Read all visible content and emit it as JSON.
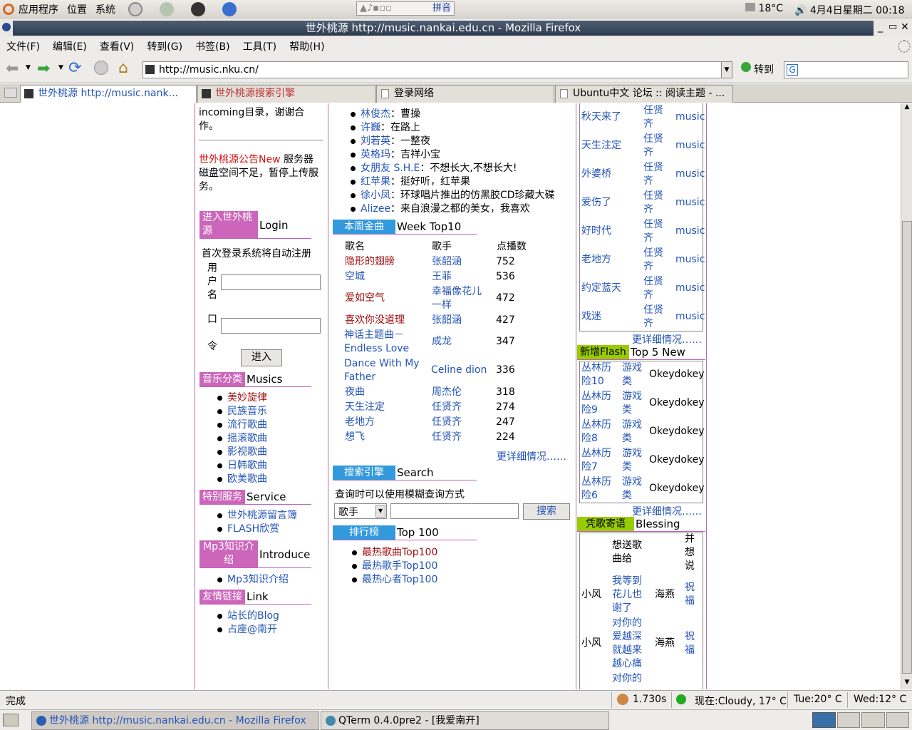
{
  "panel": {
    "apps": "应用程序",
    "places": "位置",
    "system": "系统",
    "ime_label": "拼音",
    "temp": "18°C",
    "datetime": "4月4日星期二  00:18"
  },
  "window": {
    "title": "世外桃源 http://music.nankai.edu.cn - Mozilla Firefox"
  },
  "menu": [
    "文件(F)",
    "编辑(E)",
    "查看(V)",
    "转到(G)",
    "书签(B)",
    "工具(T)",
    "帮助(H)"
  ],
  "nav": {
    "url": "http://music.nku.cn/",
    "go_label": "转到"
  },
  "tabs": [
    "世外桃源 http://music.nank...",
    "世外桃源搜索引擎",
    "登录网络",
    "Ubuntu中文 论坛 :: 阅读主题 - ..."
  ],
  "left": {
    "intro_text": "incoming目录，谢谢合作。",
    "notice_title": "世外桃源公告New",
    "notice_body": "服务器磁盘空间不足，暂停上传服务。",
    "login_tag": "进入世外桃源",
    "login_en": "Login",
    "login_note": "首次登录系统将自动注册",
    "user_label": "用户名",
    "pass_label": "口令",
    "enter_button": "进入",
    "music_tag": "音乐分类",
    "music_en": "Musics",
    "music_items": [
      "美妙旋律",
      "民族音乐",
      "流行歌曲",
      "摇滚歌曲",
      "影视歌曲",
      "日韩歌曲",
      "欧美歌曲"
    ],
    "service_tag": "特别服务",
    "service_en": "Service",
    "service_items": [
      "世外桃源留言簿",
      "FLASH欣赏"
    ],
    "mp3_tag": "Mp3知识介绍",
    "mp3_en": "Introduce",
    "mp3_items": [
      "Mp3知识介绍"
    ],
    "link_tag": "友情链接",
    "link_en": "Link",
    "link_items": [
      "站长的Blog",
      "占座@南开"
    ]
  },
  "middle": {
    "news": [
      {
        "who": "林俊杰",
        "what": "曹操"
      },
      {
        "who": "许巍",
        "what": "在路上"
      },
      {
        "who": "刘若英",
        "what": "一整夜"
      },
      {
        "who": "英格玛",
        "what": "吉祥小宝"
      },
      {
        "who": "女朋友 S.H.E",
        "what": "不想长大,不想长大!"
      },
      {
        "who": "红苹果",
        "what": "挺好听，红苹果"
      },
      {
        "who": "徐小凤",
        "what": "环球唱片推出的仿黑胶CD珍藏大碟"
      },
      {
        "who": "Alizee",
        "what": "来自浪漫之都的美女，我喜欢"
      }
    ],
    "week_tag": "本周金曲",
    "week_en": "Week Top10",
    "week_headers": [
      "歌名",
      "歌手",
      "点播数"
    ],
    "week_rows": [
      {
        "song": "隐形的翅膀",
        "singer": "张韶涵",
        "plays": "752"
      },
      {
        "song": "空城",
        "singer": "王菲",
        "plays": "536"
      },
      {
        "song": "爱如空气",
        "singer": "幸福像花儿一样",
        "plays": "472"
      },
      {
        "song": "喜欢你没道理",
        "singer": "张韶涵",
        "plays": "427"
      },
      {
        "song": "神话主题曲－Endless Love",
        "singer": "成龙",
        "plays": "347"
      },
      {
        "song": "Dance With My Father",
        "singer": "Celine dion",
        "plays": "336"
      },
      {
        "song": "夜曲",
        "singer": "周杰伦",
        "plays": "318"
      },
      {
        "song": "天生注定",
        "singer": "任贤齐",
        "plays": "274"
      },
      {
        "song": "老地方",
        "singer": "任贤齐",
        "plays": "247"
      },
      {
        "song": "想飞",
        "singer": "任贤齐",
        "plays": "224"
      }
    ],
    "more": "更详细情况……",
    "search_tag": "搜索引擎",
    "search_en": "Search",
    "search_note": "查询时可以使用模糊查询方式",
    "search_select": "歌手",
    "search_button": "搜索",
    "rank_tag": "排行榜",
    "rank_en": "Top 100",
    "rank_items": [
      "最热歌曲Top100",
      "最热歌手Top100",
      "最热心者Top100"
    ]
  },
  "right": {
    "songs": [
      {
        "song": "秋天来了",
        "singer": "任贤齐",
        "type": "music"
      },
      {
        "song": "天生注定",
        "singer": "任贤齐",
        "type": "music"
      },
      {
        "song": "外婆桥",
        "singer": "任贤齐",
        "type": "music"
      },
      {
        "song": "爱伤了",
        "singer": "任贤齐",
        "type": "music"
      },
      {
        "song": "好时代",
        "singer": "任贤齐",
        "type": "music"
      },
      {
        "song": "老地方",
        "singer": "任贤齐",
        "type": "music"
      },
      {
        "song": "约定蓝天",
        "singer": "任贤齐",
        "type": "music"
      },
      {
        "song": "戏迷",
        "singer": "任贤齐",
        "type": "music"
      }
    ],
    "more": "更详细情况……",
    "flash_tag": "新增Flash",
    "flash_en": "Top 5 New",
    "flash": [
      {
        "name": "丛林历险10",
        "type": "游戏类",
        "author": "Okeydokey"
      },
      {
        "name": "丛林历险9",
        "type": "游戏类",
        "author": "Okeydokey"
      },
      {
        "name": "丛林历险8",
        "type": "游戏类",
        "author": "Okeydokey"
      },
      {
        "name": "丛林历险7",
        "type": "游戏类",
        "author": "Okeydokey"
      },
      {
        "name": "丛林历险6",
        "type": "游戏类",
        "author": "Okeydokey"
      }
    ],
    "bless_tag": "凭歌寄语",
    "bless_en": "Blessing",
    "bless_header": {
      "song": "想送歌曲给",
      "extra": "并想说"
    },
    "bless_rows": [
      {
        "from": "小风",
        "song": "我等到花儿也谢了",
        "to": "海燕",
        "msg": "祝福"
      },
      {
        "from": "小风",
        "song": "对你的爱越深就越来越心痛",
        "to": "海燕",
        "msg": "祝福"
      },
      {
        "from": "",
        "song": "对你的",
        "to": "",
        "msg": ""
      }
    ]
  },
  "status": {
    "text": "完成",
    "time": "1.730s",
    "weather_now": "现在:Cloudy, 17° C",
    "tue": "Tue:20° C",
    "wed": "Wed:12° C"
  },
  "taskbar": [
    "世外桃源  http://music.nankai.edu.cn - Mozilla Firefox",
    "QTerm 0.4.0pre2 - [我爱南开]"
  ]
}
